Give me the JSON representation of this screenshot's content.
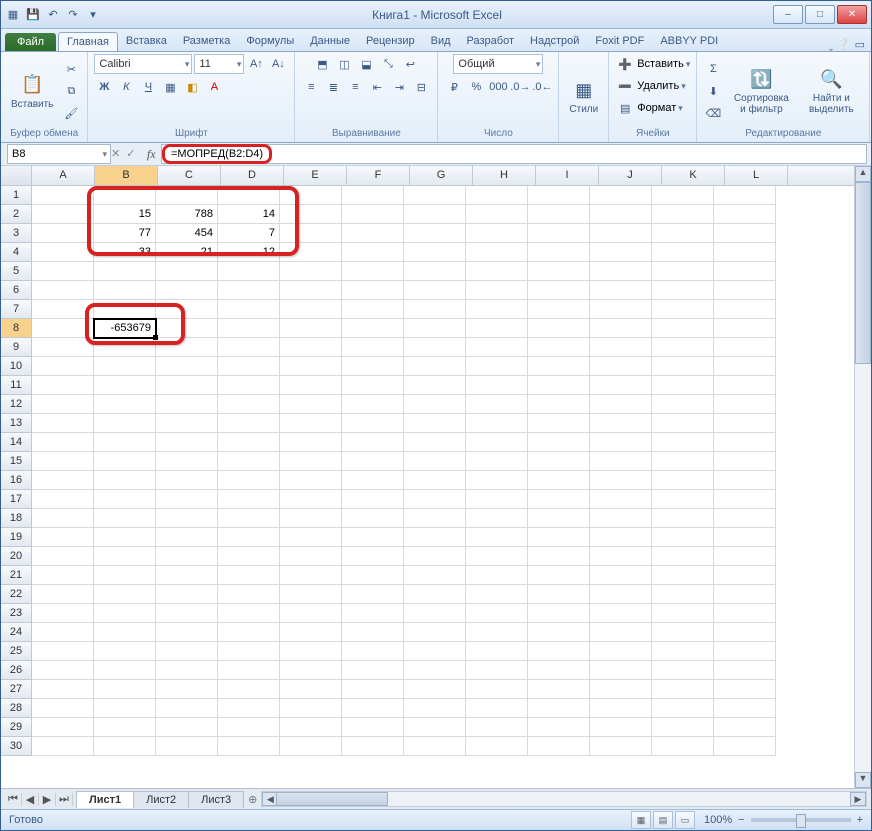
{
  "title": "Книга1 - Microsoft Excel",
  "tabs": {
    "file": "Файл",
    "list": [
      "Главная",
      "Вставка",
      "Разметка",
      "Формулы",
      "Данные",
      "Рецензир",
      "Вид",
      "Разработ",
      "Надстрой",
      "Foxit PDF",
      "ABBYY PDI"
    ],
    "active": "Главная"
  },
  "groups": {
    "clipboard": {
      "label": "Буфер обмена",
      "paste": "Вставить"
    },
    "font": {
      "label": "Шрифт",
      "name": "Calibri",
      "size": "11"
    },
    "align": {
      "label": "Выравнивание"
    },
    "number": {
      "label": "Число",
      "format": "Общий"
    },
    "styles": {
      "label": "Стили",
      "btn": "Стили"
    },
    "cells": {
      "label": "Ячейки",
      "insert": "Вставить",
      "delete": "Удалить",
      "format": "Формат"
    },
    "editing": {
      "label": "Редактирование",
      "sort": "Сортировка и фильтр",
      "find": "Найти и выделить"
    }
  },
  "namebox": "B8",
  "formula": "=МОПРЕД(B2:D4)",
  "columns": [
    "A",
    "B",
    "C",
    "D",
    "E",
    "F",
    "G",
    "H",
    "I",
    "J",
    "K",
    "L"
  ],
  "rows": 30,
  "activeCell": {
    "row": 8,
    "col": "B"
  },
  "cells": {
    "B2": "15",
    "C2": "788",
    "D2": "14",
    "B3": "77",
    "C3": "454",
    "D3": "7",
    "B4": "33",
    "C4": "21",
    "D4": "12",
    "B8": "-653679"
  },
  "sheets": {
    "list": [
      "Лист1",
      "Лист2",
      "Лист3"
    ],
    "active": "Лист1"
  },
  "status": {
    "ready": "Готово",
    "zoom": "100%"
  }
}
